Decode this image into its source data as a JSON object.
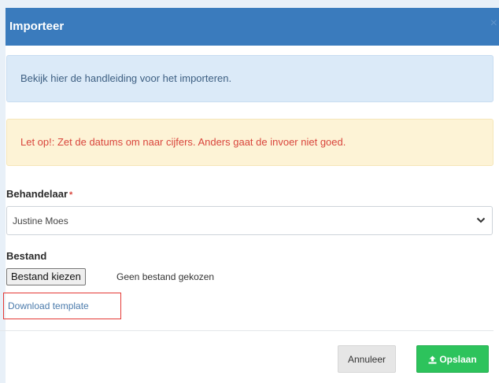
{
  "modal": {
    "title": "Importeer",
    "close_symbol": "×"
  },
  "alerts": {
    "info": "Bekijk hier de handleiding voor het importeren.",
    "warning": "Let op!: Zet de datums om naar cijfers. Anders gaat de invoer niet goed."
  },
  "form": {
    "behandelaar_label": "Behandelaar",
    "required_mark": "*",
    "behandelaar_value": "Justine Moes",
    "bestand_label": "Bestand",
    "file_button_label": "Bestand kiezen",
    "file_status": "Geen bestand gekozen",
    "download_link": "Download template"
  },
  "footer": {
    "cancel_label": "Annuleer",
    "save_label": "Opslaan"
  },
  "icons": {
    "close": "close-icon",
    "select_arrow": "chevron-down-icon",
    "save": "upload-icon"
  },
  "colors": {
    "header": "#3a7bbd",
    "info_bg": "#dbeaf8",
    "warning_bg": "#fdf3d6",
    "warning_text": "#d9453c",
    "save_button": "#2dc35c",
    "highlight_border": "#e53935"
  }
}
